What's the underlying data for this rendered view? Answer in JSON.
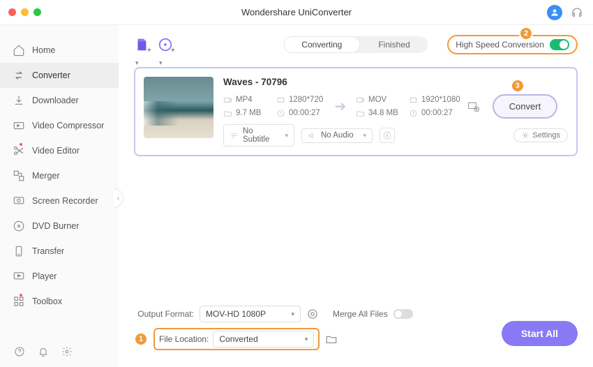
{
  "app_title": "Wondershare UniConverter",
  "sidebar": {
    "items": [
      {
        "label": "Home",
        "icon": "home"
      },
      {
        "label": "Converter",
        "icon": "converter",
        "active": true
      },
      {
        "label": "Downloader",
        "icon": "downloader"
      },
      {
        "label": "Video Compressor",
        "icon": "compressor"
      },
      {
        "label": "Video Editor",
        "icon": "editor",
        "notif": true
      },
      {
        "label": "Merger",
        "icon": "merger"
      },
      {
        "label": "Screen Recorder",
        "icon": "recorder"
      },
      {
        "label": "DVD Burner",
        "icon": "dvd"
      },
      {
        "label": "Transfer",
        "icon": "transfer"
      },
      {
        "label": "Player",
        "icon": "player"
      },
      {
        "label": "Toolbox",
        "icon": "toolbox",
        "notif": true
      }
    ]
  },
  "tabs": {
    "converting": "Converting",
    "finished": "Finished"
  },
  "high_speed_label": "High Speed Conversion",
  "file": {
    "title": "Waves - 70796",
    "src": {
      "format": "MP4",
      "resolution": "1280*720",
      "size": "9.7 MB",
      "duration": "00:00:27"
    },
    "dst": {
      "format": "MOV",
      "resolution": "1920*1080",
      "size": "34.8 MB",
      "duration": "00:00:27"
    },
    "subtitle": "No Subtitle",
    "audio": "No Audio",
    "settings_label": "Settings",
    "convert_label": "Convert"
  },
  "bottom": {
    "output_format_label": "Output Format:",
    "output_format_value": "MOV-HD 1080P",
    "file_location_label": "File Location:",
    "file_location_value": "Converted",
    "merge_label": "Merge All Files",
    "start_all": "Start All"
  },
  "step_badges": {
    "one": "1",
    "two": "2",
    "three": "3"
  }
}
